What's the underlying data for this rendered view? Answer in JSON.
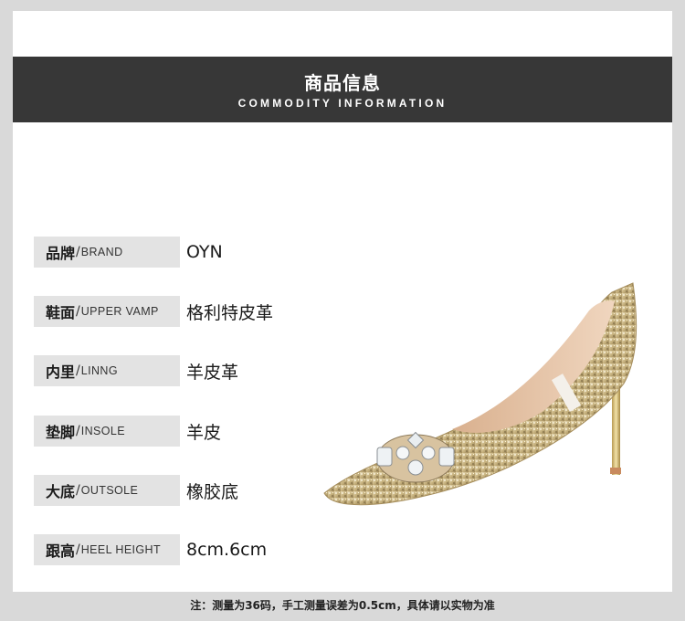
{
  "header": {
    "title": "商品信息",
    "subtitle": "COMMODITY INFORMATION"
  },
  "specs": [
    {
      "label_zh": "品牌",
      "label_en": "BRAND",
      "value": "OYN"
    },
    {
      "label_zh": "鞋面",
      "label_en": "UPPER VAMP",
      "value": "格利特皮革"
    },
    {
      "label_zh": "内里",
      "label_en": "LINNG",
      "value": "羊皮革"
    },
    {
      "label_zh": "垫脚",
      "label_en": "INSOLE",
      "value": "羊皮"
    },
    {
      "label_zh": "大底",
      "label_en": "OUTSOLE",
      "value": "橡胶底"
    },
    {
      "label_zh": "跟高",
      "label_en": "HEEL HEIGHT",
      "value": "8cm.6cm"
    }
  ],
  "separator": "/",
  "footnote": "注：测量为36码，手工测量误差为0.5cm，具体请以实物为准",
  "colors": {
    "banner": "#373737",
    "label_bg": "#e3e3e3",
    "frame": "#d9d9d9",
    "shoe_gold": "#cdbb8e"
  }
}
